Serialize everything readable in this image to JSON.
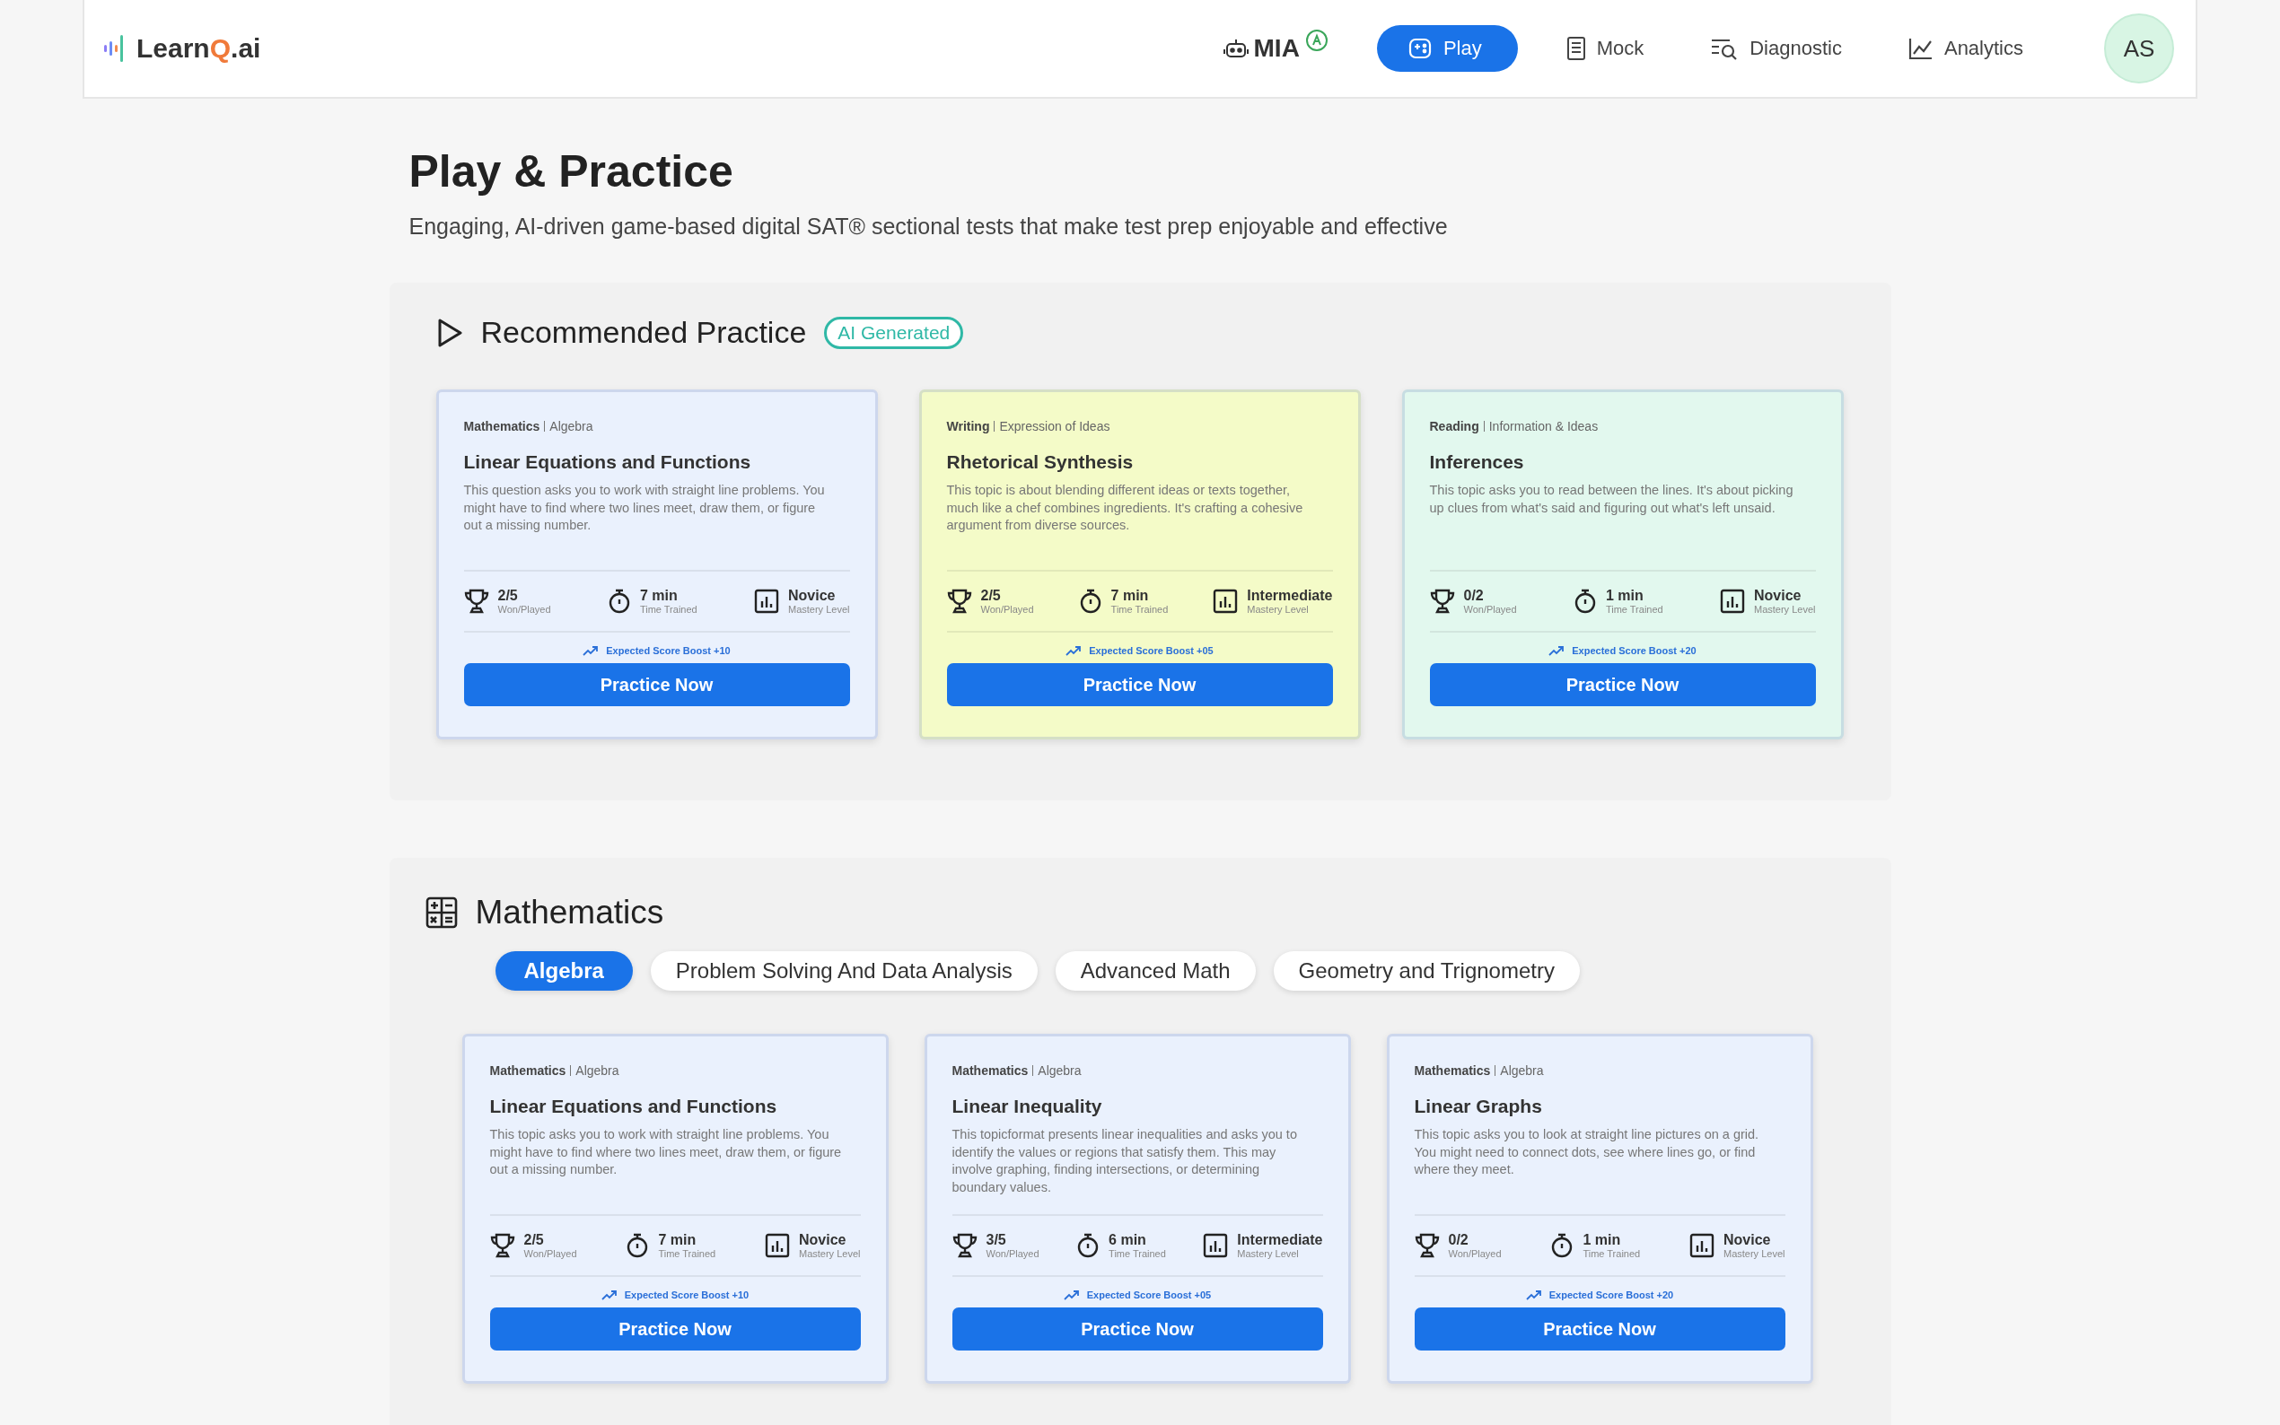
{
  "header": {
    "logo": {
      "before": "Learn",
      "accent": "Q",
      "after": ".ai"
    },
    "nav": [
      {
        "label": "MIA",
        "kind": "mia",
        "selected": false
      },
      {
        "label": "Play",
        "kind": "play",
        "selected": true
      },
      {
        "label": "Mock",
        "kind": "mock",
        "selected": false
      },
      {
        "label": "Diagnostic",
        "kind": "diagnostic",
        "selected": false
      },
      {
        "label": "Analytics",
        "kind": "analytics",
        "selected": false
      }
    ],
    "avatar": "AS"
  },
  "page": {
    "title": "Play & Practice",
    "subtitle": "Engaging, AI-driven game-based digital SAT® sectional tests that make test prep enjoyable and effective"
  },
  "recommended": {
    "title": "Recommended Practice",
    "badge": "AI Generated",
    "cards": [
      {
        "subject": "Mathematics",
        "topic": "Algebra",
        "title": "Linear Equations and Functions",
        "description": "This question asks you to work with straight line problems. You might have to find where two lines meet, draw them, or figure out a missing number.",
        "color": "#eaf1fd",
        "stats": [
          {
            "kind": "trophy",
            "value": "2/5",
            "label": "Won/Played"
          },
          {
            "kind": "timer",
            "value": "7 min",
            "label": "Time Trained"
          },
          {
            "kind": "mastery",
            "value": "Novice",
            "label": "Mastery Level"
          }
        ],
        "boost": "Expected Score Boost +10",
        "button": "Practice Now"
      },
      {
        "subject": "Writing",
        "topic": "Expression of Ideas",
        "title": "Rhetorical Synthesis",
        "description": "This topic is about blending different ideas or texts together, much like a chef combines ingredients. It's crafting a cohesive argument from diverse sources.",
        "color": "#f4fbc8",
        "stats": [
          {
            "kind": "trophy",
            "value": "2/5",
            "label": "Won/Played"
          },
          {
            "kind": "timer",
            "value": "7 min",
            "label": "Time Trained"
          },
          {
            "kind": "mastery",
            "value": "Intermediate",
            "label": "Mastery Level"
          }
        ],
        "boost": "Expected Score Boost +05",
        "button": "Practice Now"
      },
      {
        "subject": "Reading",
        "topic": "Information & Ideas",
        "title": "Inferences",
        "description": "This topic asks you to read between the lines. It's about picking up clues from what's said and figuring out what's left unsaid.",
        "color": "#e2f8ee",
        "stats": [
          {
            "kind": "trophy",
            "value": "0/2",
            "label": "Won/Played"
          },
          {
            "kind": "timer",
            "value": "1 min",
            "label": "Time Trained"
          },
          {
            "kind": "mastery",
            "value": "Novice",
            "label": "Mastery Level"
          }
        ],
        "boost": "Expected Score Boost +20",
        "button": "Practice Now"
      }
    ]
  },
  "mathematics": {
    "title": "Mathematics",
    "tabs": [
      {
        "label": "Algebra",
        "selected": true
      },
      {
        "label": "Problem Solving And Data Analysis",
        "selected": false
      },
      {
        "label": "Advanced Math",
        "selected": false
      },
      {
        "label": "Geometry and Trignometry",
        "selected": false
      }
    ],
    "cards": [
      {
        "subject": "Mathematics",
        "topic": "Algebra",
        "title": "Linear Equations and Functions",
        "description": "This topic asks you to work with straight line problems. You might have to find where two lines meet, draw them, or figure out a missing number.",
        "color": "#eaf1fd",
        "stats": [
          {
            "kind": "trophy",
            "value": "2/5",
            "label": "Won/Played"
          },
          {
            "kind": "timer",
            "value": "7 min",
            "label": "Time Trained"
          },
          {
            "kind": "mastery",
            "value": "Novice",
            "label": "Mastery Level"
          }
        ],
        "boost": "Expected Score Boost +10",
        "button": "Practice Now"
      },
      {
        "subject": "Mathematics",
        "topic": "Algebra",
        "title": "Linear Inequality",
        "description": "This topicformat presents linear inequalities and asks you to identify the values or regions that satisfy them. This may involve graphing, finding intersections, or determining boundary values.",
        "color": "#eaf1fd",
        "stats": [
          {
            "kind": "trophy",
            "value": "3/5",
            "label": "Won/Played"
          },
          {
            "kind": "timer",
            "value": "6 min",
            "label": "Time Trained"
          },
          {
            "kind": "mastery",
            "value": "Intermediate",
            "label": "Mastery Level"
          }
        ],
        "boost": "Expected Score Boost +05",
        "button": "Practice Now"
      },
      {
        "subject": "Mathematics",
        "topic": "Algebra",
        "title": "Linear Graphs",
        "description": "This topic asks you to look at straight line pictures on a grid. You might need to connect dots, see where lines go, or find where they meet.",
        "color": "#eaf1fd",
        "stats": [
          {
            "kind": "trophy",
            "value": "0/2",
            "label": "Won/Played"
          },
          {
            "kind": "timer",
            "value": "1 min",
            "label": "Time Trained"
          },
          {
            "kind": "mastery",
            "value": "Novice",
            "label": "Mastery Level"
          }
        ],
        "boost": "Expected Score Boost +20",
        "button": "Practice Now"
      }
    ]
  }
}
